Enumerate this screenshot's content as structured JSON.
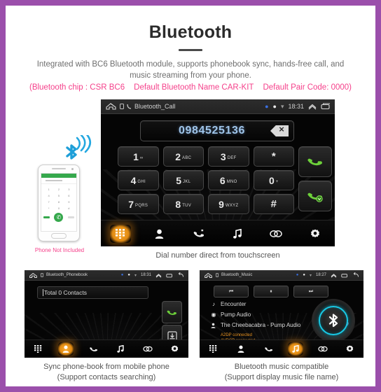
{
  "theme": {
    "border_color": "#9b4fab",
    "accent_pink": "#f5418b",
    "dock_active": "#ffae33",
    "bt_cyan": "#18c8e4",
    "call_green": "#6dd13a",
    "number_blue": "#9fc4e8",
    "status_orange": "#e8921f"
  },
  "header": {
    "title": "Bluetooth",
    "subtitle_line1": "Integrated with BC6 Bluetooth module, supports phonebook sync, hands-free call, and",
    "subtitle_line2": "music streaming from your phone.",
    "spec_chip": "(Bluetooth chip : CSR BC6",
    "spec_name": "Default Bluetooth Name CAR-KIT",
    "spec_pair": "Default Pair Code: 0000)"
  },
  "main_screen": {
    "statusbar": {
      "title": "Bluetooth_Call",
      "time": "18:31",
      "icons": [
        "home-icon",
        "sd-card-icon",
        "call-icon",
        "bluetooth-dot",
        "wifi-dot",
        "volume-dot",
        "collapse-icon",
        "recent-apps-icon"
      ]
    },
    "dialed_number": "0984525136",
    "backspace_label": "×",
    "keys": [
      [
        {
          "digit": "1",
          "sub": "∞"
        },
        {
          "digit": "2",
          "sub": "ABC"
        },
        {
          "digit": "3",
          "sub": "DEF"
        },
        {
          "digit": "*",
          "sub": ""
        }
      ],
      [
        {
          "digit": "4",
          "sub": "GHI"
        },
        {
          "digit": "5",
          "sub": "JKL"
        },
        {
          "digit": "6",
          "sub": "MNO"
        },
        {
          "digit": "0",
          "sub": "+"
        }
      ],
      [
        {
          "digit": "7",
          "sub": "PQRS"
        },
        {
          "digit": "8",
          "sub": "TUV"
        },
        {
          "digit": "9",
          "sub": "WXYZ"
        },
        {
          "digit": "#",
          "sub": ""
        }
      ]
    ],
    "call_button": "answer-call",
    "hangup_button": "end-call",
    "dock": [
      {
        "name": "dialpad",
        "active": true
      },
      {
        "name": "contacts",
        "active": false
      },
      {
        "name": "call-log",
        "active": false
      },
      {
        "name": "music",
        "active": false
      },
      {
        "name": "pair-link",
        "active": false
      },
      {
        "name": "settings",
        "active": false
      }
    ],
    "caption": "Dial number direct from touchscreen"
  },
  "phone_mock": {
    "note": "Phone Not Included",
    "keypad_labels": [
      "1",
      "2",
      "3",
      "4",
      "5",
      "6",
      "7",
      "8",
      "9",
      "*",
      "0",
      "#"
    ]
  },
  "phonebook_screen": {
    "statusbar": {
      "title": "Bluetooth_Phonebook",
      "time": "18:31"
    },
    "search_value": "Total 0 Contacts",
    "buttons": [
      {
        "name": "call-button"
      },
      {
        "name": "download-contacts-button"
      }
    ],
    "dock": [
      {
        "name": "dialpad",
        "active": false
      },
      {
        "name": "contacts",
        "active": true
      },
      {
        "name": "call-log",
        "active": false
      },
      {
        "name": "music",
        "active": false
      },
      {
        "name": "pair-link",
        "active": false
      },
      {
        "name": "settings",
        "active": false
      }
    ],
    "caption_line1": "Sync phone-book from mobile phone",
    "caption_line2": "(Support contacts searching)"
  },
  "music_screen": {
    "statusbar": {
      "title": "Bluetooth_Music",
      "time": "18:27"
    },
    "transport": [
      {
        "name": "previous-track",
        "glyph": "⏮"
      },
      {
        "name": "play-pause",
        "glyph": "⏸"
      },
      {
        "name": "next-track",
        "glyph": "⏭"
      }
    ],
    "track": "Encounter",
    "album": "Pump Audio",
    "artist": "The Cheebacabra - Pump Audio",
    "status_a2dp": "A2DP connected",
    "status_avrcp": "AVRCP connected",
    "dock": [
      {
        "name": "dialpad",
        "active": false
      },
      {
        "name": "contacts",
        "active": false
      },
      {
        "name": "call-log",
        "active": false
      },
      {
        "name": "music",
        "active": true
      },
      {
        "name": "pair-link",
        "active": false
      },
      {
        "name": "settings",
        "active": false
      }
    ],
    "caption_line1": "Bluetooth music compatible",
    "caption_line2": "(Support display music file name)"
  }
}
